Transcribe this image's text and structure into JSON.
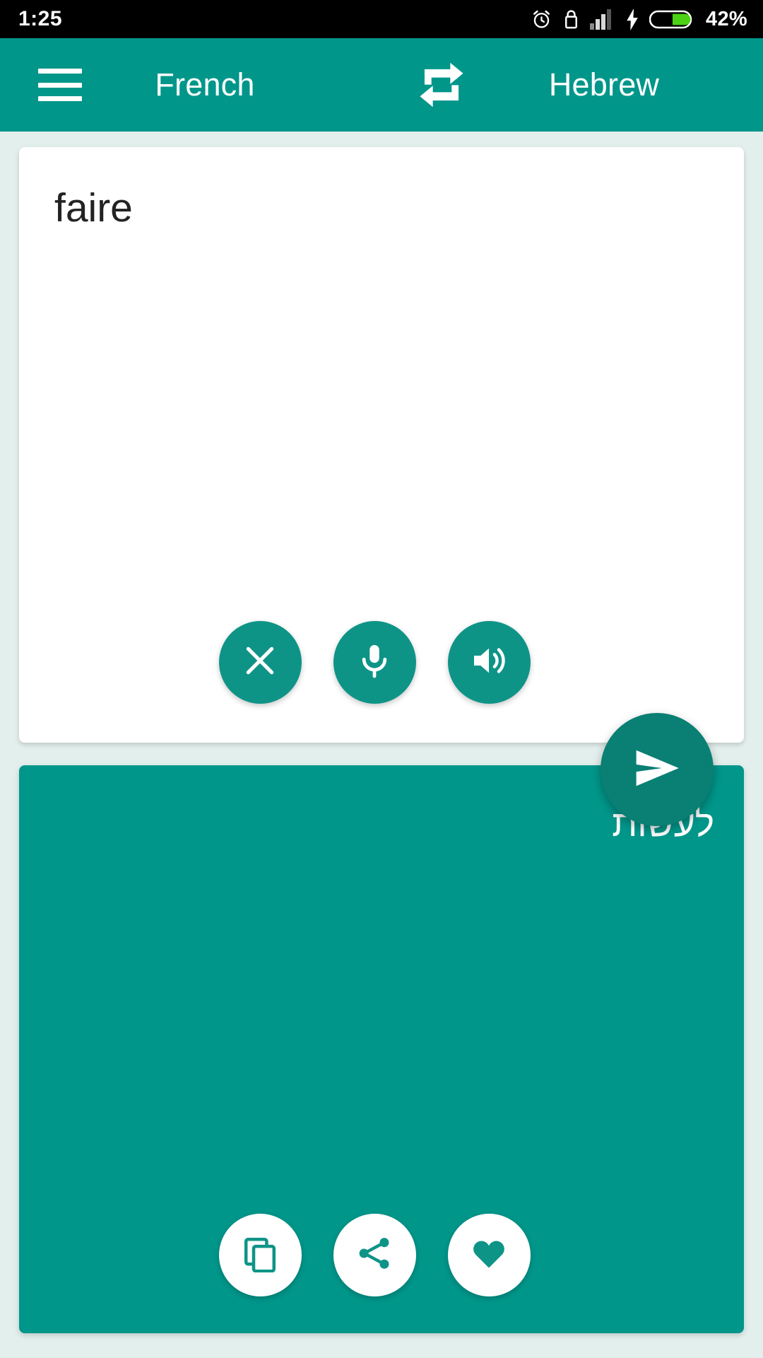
{
  "statusbar": {
    "time": "1:25",
    "battery_percent": "42%",
    "icons": [
      "alarm-icon",
      "lock-icon",
      "signal-icon",
      "charging-bolt-icon",
      "battery-icon"
    ]
  },
  "appbar": {
    "menu_icon": "hamburger-menu-icon",
    "source_language": "French",
    "swap_icon": "swap-languages-icon",
    "target_language": "Hebrew"
  },
  "input_card": {
    "text": "faire",
    "placeholder": "",
    "actions": [
      {
        "name": "clear-button",
        "icon": "close-x-icon"
      },
      {
        "name": "voice-input-button",
        "icon": "microphone-icon"
      },
      {
        "name": "speak-source-button",
        "icon": "speaker-volume-icon"
      }
    ]
  },
  "translate_button": {
    "name": "translate-send-button",
    "icon": "send-icon"
  },
  "output_card": {
    "text": "לעשות",
    "actions": [
      {
        "name": "copy-button",
        "icon": "copy-icon"
      },
      {
        "name": "share-button",
        "icon": "share-icon"
      },
      {
        "name": "favorite-button",
        "icon": "heart-icon"
      }
    ]
  },
  "colors": {
    "primary": "#00968a",
    "primary_dark": "#0a7f74",
    "fab_teal": "#0e9487",
    "background": "#e3efed",
    "card_white": "#ffffff",
    "battery_green": "#4cd215",
    "status_bar": "#000000"
  }
}
